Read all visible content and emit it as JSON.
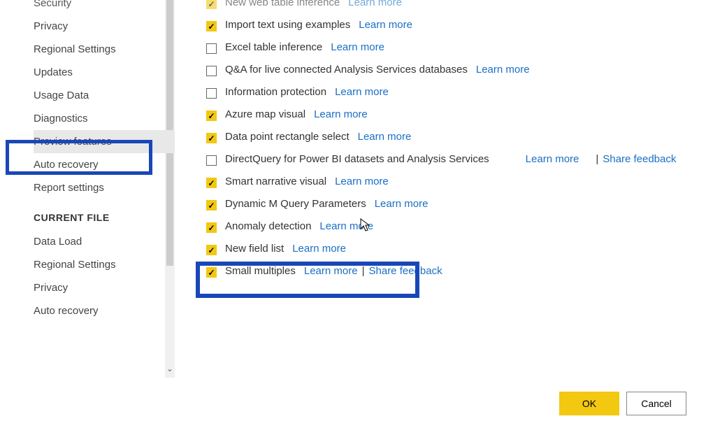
{
  "sidebar": {
    "global_items": [
      "Security",
      "Privacy",
      "Regional Settings",
      "Updates",
      "Usage Data",
      "Diagnostics",
      "Preview features",
      "Auto recovery",
      "Report settings"
    ],
    "section_header": "CURRENT FILE",
    "file_items": [
      "Data Load",
      "Regional Settings",
      "Privacy",
      "Auto recovery"
    ]
  },
  "features": {
    "cut_top": {
      "checked": true,
      "label": "New web table inference",
      "learn": "Learn more"
    },
    "list": [
      {
        "checked": true,
        "label": "Import text using examples",
        "learn": "Learn more"
      },
      {
        "checked": false,
        "label": "Excel table inference",
        "learn": "Learn more"
      },
      {
        "checked": false,
        "label": "Q&A for live connected Analysis Services databases",
        "learn": "Learn more"
      },
      {
        "checked": false,
        "label": "Information protection",
        "learn": "Learn more"
      },
      {
        "checked": true,
        "label": "Azure map visual",
        "learn": "Learn more"
      },
      {
        "checked": true,
        "label": "Data point rectangle select",
        "learn": "Learn more"
      }
    ],
    "direct_query": {
      "checked": false,
      "label": "DirectQuery for Power BI datasets and Analysis Services",
      "learn": "Learn more",
      "share": "Share feedback"
    },
    "post": [
      {
        "checked": true,
        "label": "Smart narrative visual",
        "learn": "Learn more"
      },
      {
        "checked": true,
        "label": "Dynamic M Query Parameters",
        "learn": "Learn more"
      },
      {
        "checked": true,
        "label": "Anomaly detection",
        "learn": "Learn more"
      },
      {
        "checked": true,
        "label": "New field list",
        "learn": "Learn more"
      }
    ],
    "small_multiples": {
      "checked": true,
      "label": "Small multiples",
      "learn": "Learn more",
      "share": "Share feedback"
    }
  },
  "footer": {
    "ok": "OK",
    "cancel": "Cancel"
  }
}
